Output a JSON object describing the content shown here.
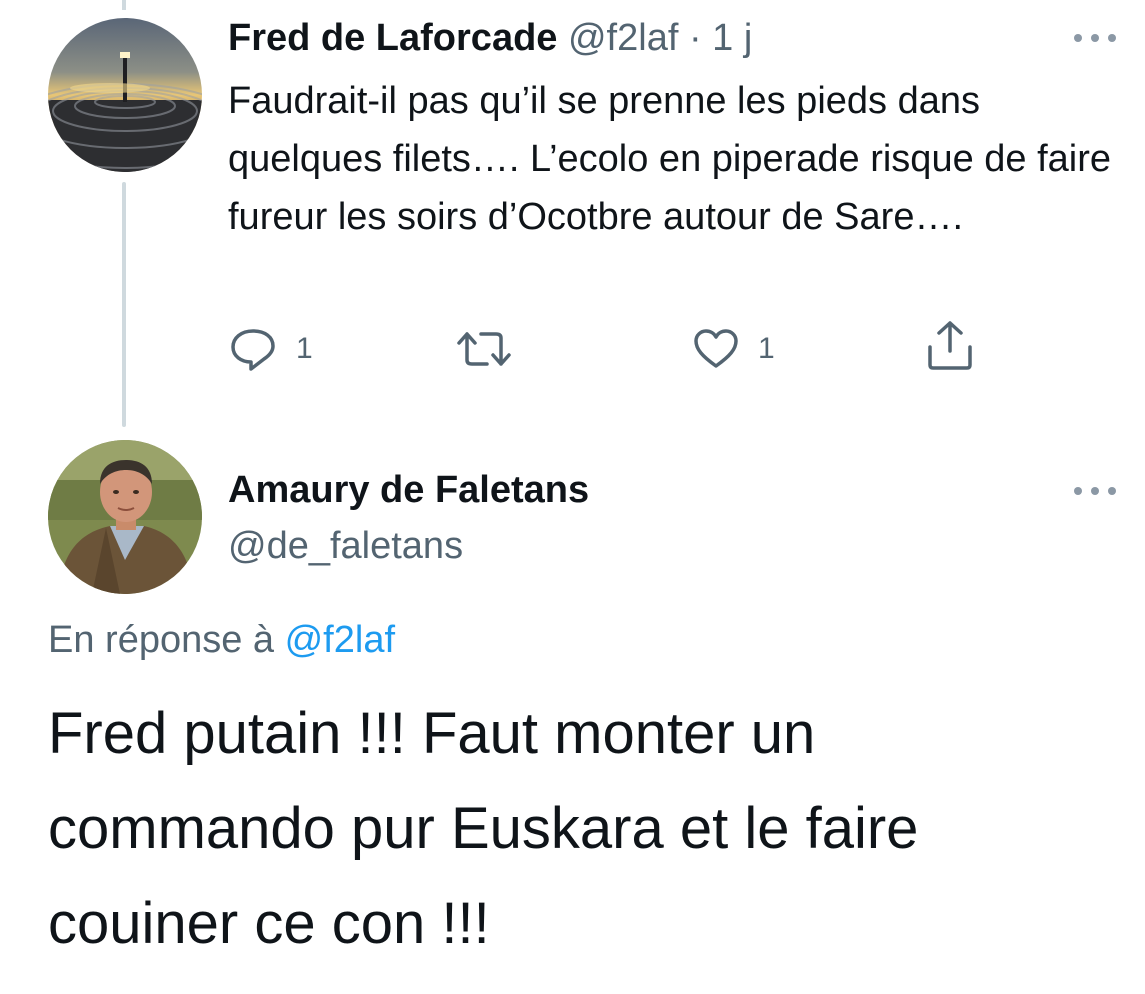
{
  "tweet1": {
    "author_name": "Fred de Laforcade",
    "handle": "@f2laf",
    "separator": " · ",
    "time": "1 j",
    "text": "Faudrait-il pas qu’il se prenne les pieds dans quelques filets…. L’ecolo en piperade risque de faire fureur les soirs d’Ocotbre autour de Sare….",
    "reply_count": "1",
    "like_count": "1",
    "avatar_icon": "solar-tower-avatar"
  },
  "tweet2": {
    "author_name": "Amaury de Faletans",
    "handle": "@de_faletans",
    "reply_to_prefix": "En réponse à ",
    "reply_to_handle": "@f2laf",
    "text": "Fred putain !!! Faut monter un commando pur Euskara et le faire couiner ce con !!!",
    "avatar_icon": "man-portrait-avatar"
  },
  "icons": {
    "reply": "reply-icon",
    "retweet": "retweet-icon",
    "like": "like-icon",
    "share": "share-icon",
    "more": "more-icon"
  },
  "colors": {
    "text": "#0f1419",
    "secondary": "#536471",
    "link": "#1d9bf0",
    "thread_line": "#cfd9de"
  }
}
